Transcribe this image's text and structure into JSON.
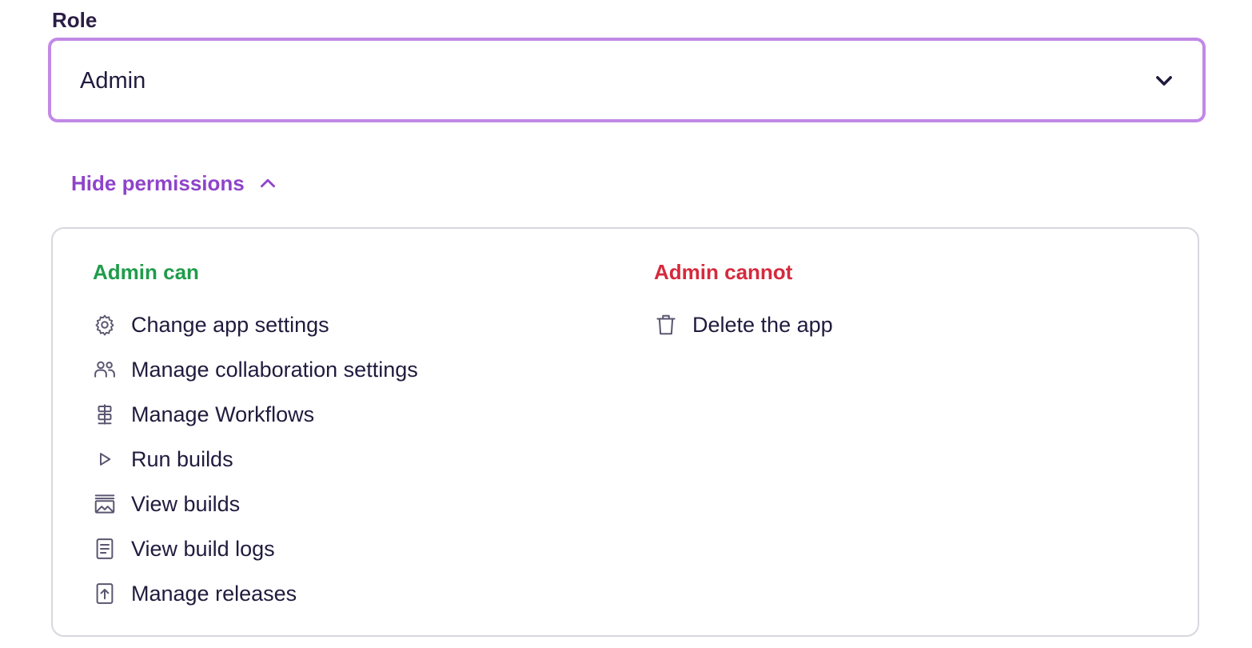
{
  "role_field": {
    "label": "Role",
    "selected": "Admin",
    "icon": "chevron-down-icon",
    "focus_border_color": "#c289e6"
  },
  "permissions_toggle": {
    "label": "Hide permissions",
    "icon": "chevron-up-icon",
    "color": "#8f43c9"
  },
  "permissions": {
    "can": {
      "title": "Admin can",
      "color": "#1f9c4a",
      "items": [
        {
          "label": "Change app settings",
          "icon": "gear-icon"
        },
        {
          "label": "Manage collaboration settings",
          "icon": "users-icon"
        },
        {
          "label": "Manage Workflows",
          "icon": "workflow-icon"
        },
        {
          "label": "Run builds",
          "icon": "play-icon"
        },
        {
          "label": "View builds",
          "icon": "builds-icon"
        },
        {
          "label": "View build logs",
          "icon": "document-icon"
        },
        {
          "label": "Manage releases",
          "icon": "release-upload-icon"
        }
      ]
    },
    "cannot": {
      "title": "Admin cannot",
      "color": "#d6293d",
      "items": [
        {
          "label": "Delete the app",
          "icon": "trash-icon"
        }
      ]
    }
  }
}
